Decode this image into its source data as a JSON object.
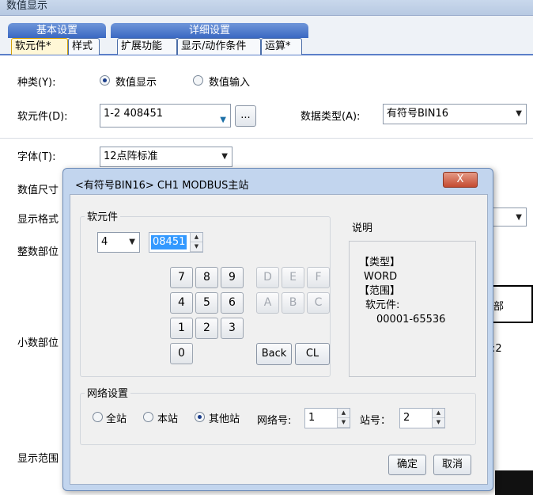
{
  "window": {
    "title": "数值显示"
  },
  "tabs": {
    "group_basic": "基本设置",
    "group_detail": "详细设置",
    "items": [
      "软元件*",
      "样式",
      "扩展功能",
      "显示/动作条件",
      "运算*"
    ]
  },
  "form": {
    "kind_label": "种类(Y):",
    "kind_options": [
      "数值显示",
      "数值输入"
    ],
    "device_label": "软元件(D):",
    "device_value": "1-2 408451",
    "browse_label": "...",
    "datatype_label": "数据类型(A):",
    "datatype_value": "有符号BIN16",
    "font_label": "字体(T):",
    "font_value": "12点阵标准",
    "size_label": "数值尺寸",
    "format_label": "显示格式",
    "int_label": "整数部位",
    "dec_label": "小数部位",
    "range_label": "显示范围",
    "partial_right_text": "部",
    "partial_ratio": ":2"
  },
  "dialog": {
    "title": "<有符号BIN16> CH1 MODBUS主站",
    "close_label": "X",
    "device_group": "软元件",
    "device_type_value": "4",
    "device_number_value": "08451",
    "keys_row1": [
      "7",
      "8",
      "9"
    ],
    "keys_row2": [
      "4",
      "5",
      "6"
    ],
    "keys_row3": [
      "1",
      "2",
      "3"
    ],
    "key_zero": "0",
    "hex_row1": [
      "D",
      "E",
      "F"
    ],
    "hex_row2": [
      "A",
      "B",
      "C"
    ],
    "back_label": "Back",
    "clear_label": "CL",
    "desc_title": "说明",
    "desc_lines": [
      "【类型】",
      "WORD",
      "【范围】",
      "软元件:",
      "00001-65536"
    ],
    "network_group": "网络设置",
    "net_options": [
      "全站",
      "本站",
      "其他站"
    ],
    "netno_label": "网络号:",
    "netno_value": "1",
    "station_label": "站号：",
    "station_value": "2",
    "ok_label": "确定",
    "cancel_label": "取消"
  }
}
